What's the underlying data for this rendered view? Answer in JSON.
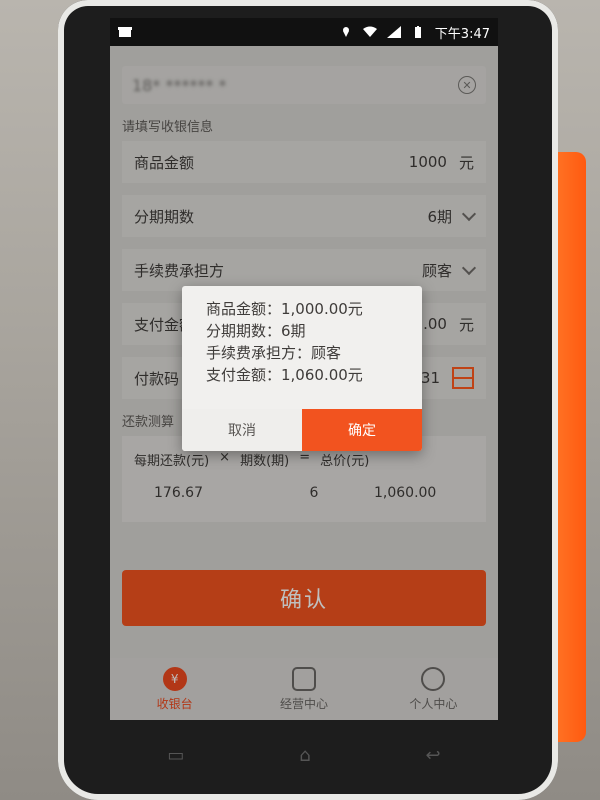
{
  "status_bar": {
    "time": "下午3:47"
  },
  "form": {
    "phone_value": "18* ****** *",
    "section_title": "请填写收银信息",
    "rows": [
      {
        "label": "商品金额",
        "value": "1000",
        "unit": "元"
      },
      {
        "label": "分期期数",
        "value": "6期"
      },
      {
        "label": "手续费承担方",
        "value": "顾客"
      },
      {
        "label": "支付金额",
        "value": ".00",
        "unit": "元"
      },
      {
        "label": "付款码",
        "value": "31"
      }
    ],
    "calc_title": "还款测算",
    "calc_header": [
      "每期还款(元)",
      "×",
      "期数(期)",
      "=",
      "总价(元)"
    ],
    "calc_values": [
      "176.67",
      "6",
      "1,060.00"
    ],
    "confirm_label": "确认"
  },
  "dialog": {
    "lines": [
      "商品金额：1,000.00元",
      "分期期数：6期",
      "手续费承担方：顾客",
      "支付金额：1,060.00元"
    ],
    "cancel": "取消",
    "ok": "确定"
  },
  "bottom_nav": [
    {
      "label": "收银台",
      "icon": "cashier-icon",
      "active": true
    },
    {
      "label": "经营中心",
      "icon": "report-icon",
      "active": false
    },
    {
      "label": "个人中心",
      "icon": "person-icon",
      "active": false
    }
  ],
  "colors": {
    "accent": "#f2531f"
  }
}
